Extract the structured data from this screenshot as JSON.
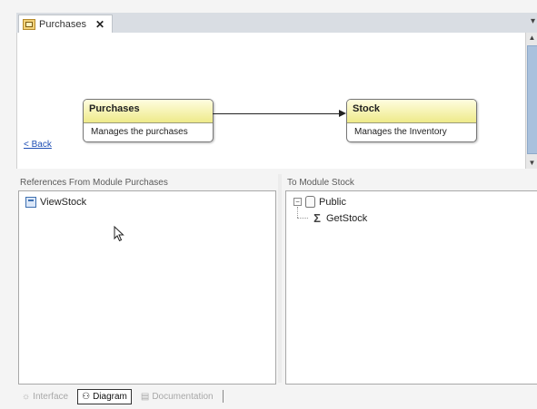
{
  "document_tab": {
    "label": "Purchases",
    "close": "✕",
    "pin": "▾"
  },
  "diagram": {
    "source_module": {
      "name": "Purchases",
      "description": "Manages the purchases"
    },
    "target_module": {
      "name": "Stock",
      "description": "Manages the Inventory"
    },
    "back_link": "< Back"
  },
  "scrollbar": {
    "up": "▲",
    "down": "▼"
  },
  "references_pane": {
    "header": "References From Module Purchases",
    "items": [
      {
        "label": "ViewStock",
        "icon": "view-icon"
      }
    ]
  },
  "target_pane": {
    "header": "To Module Stock",
    "tree": {
      "expander": "−",
      "node": {
        "label": "Public",
        "icon": "hand-icon"
      },
      "children": [
        {
          "label": "GetStock",
          "icon": "procedure-icon",
          "glyph": "Σ"
        }
      ]
    }
  },
  "bottom_tabs": [
    {
      "label": "Interface",
      "icon": "☼",
      "active": false
    },
    {
      "label": "Diagram",
      "icon": "⚇",
      "active": true
    },
    {
      "label": "Documentation",
      "icon": "▤",
      "active": false
    }
  ]
}
